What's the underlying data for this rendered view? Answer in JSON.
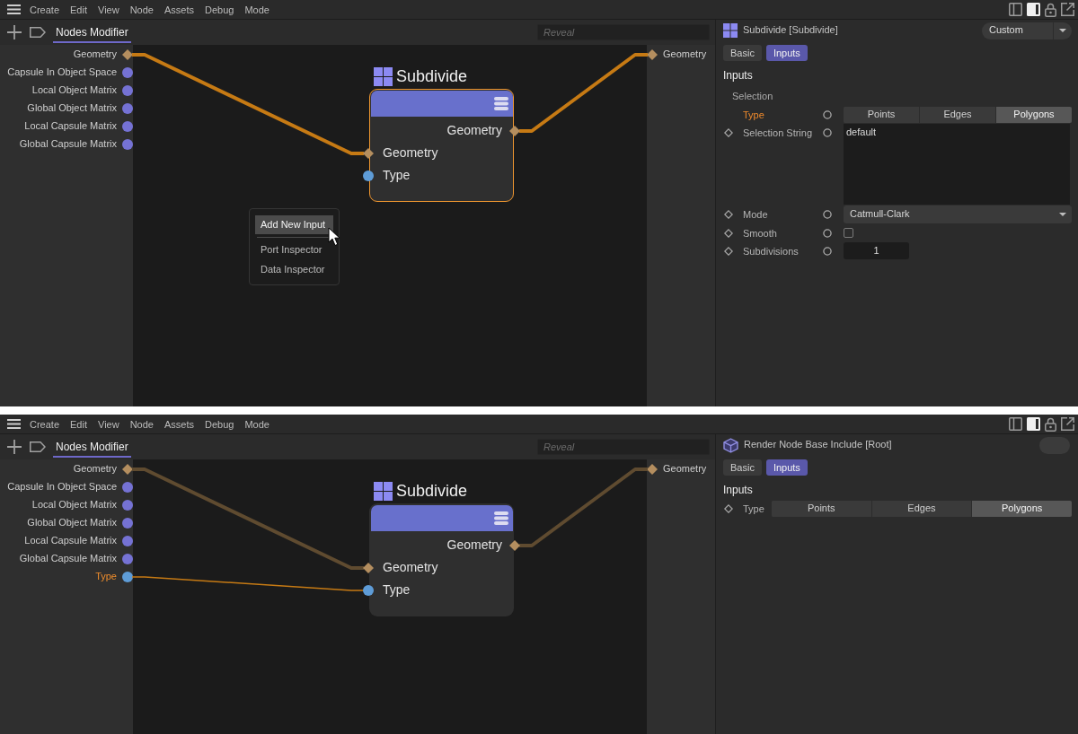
{
  "panels": [
    {
      "menu_bar": [
        "Create",
        "Edit",
        "View",
        "Node",
        "Assets",
        "Debug",
        "Mode"
      ],
      "editor": {
        "tabs": [
          {
            "label": "Nodes Modifier",
            "selected": true
          }
        ],
        "search": {
          "placeholder": "Reveal"
        },
        "graph_inputs": [
          {
            "label": "Geometry",
            "kind": "geometry",
            "highlighted": false,
            "wire": {
              "selected": true
            }
          },
          {
            "label": "Capsule In Object Space",
            "kind": "data",
            "highlighted": false
          },
          {
            "label": "Local Object Matrix",
            "kind": "data",
            "highlighted": false
          },
          {
            "label": "Global Object Matrix",
            "kind": "data",
            "highlighted": false
          },
          {
            "label": "Local Capsule Matrix",
            "kind": "data",
            "highlighted": false
          },
          {
            "label": "Global Capsule Matrix",
            "kind": "data",
            "highlighted": false
          }
        ],
        "node": {
          "title": "Subdivide",
          "selected": true,
          "outputs": [
            {
              "label": "Geometry",
              "kind": "geometry",
              "wire": {
                "selected": true
              }
            }
          ],
          "inputs": [
            {
              "label": "Geometry",
              "kind": "geometry"
            },
            {
              "label": "Type",
              "kind": "value"
            }
          ]
        },
        "context_menu": {
          "groups": [
            [
              {
                "label": "Add New Input",
                "selected": true
              }
            ],
            [
              {
                "label": "Port Inspector",
                "selected": false
              },
              {
                "label": "Data Inspector",
                "selected": false
              }
            ]
          ]
        },
        "graph_outputs": [
          {
            "label": "Geometry",
            "kind": "geometry"
          }
        ]
      },
      "attributes": {
        "header": {
          "kind": "node",
          "title": "Subdivide [Subdivide]",
          "preset": {
            "kind": "dropdown",
            "label": "Custom"
          }
        },
        "tabs": [
          {
            "label": "Basic",
            "selected": false
          },
          {
            "label": "Inputs",
            "selected": true
          }
        ],
        "sections": [
          {
            "title": "Inputs",
            "rows": [
              {
                "kind": "group",
                "label": "Selection"
              },
              {
                "kind": "segmented",
                "label": "Type",
                "keyframe": false,
                "port": true,
                "highlighted": true,
                "options": [
                  {
                    "label": "Points",
                    "selected": false
                  },
                  {
                    "label": "Edges",
                    "selected": false
                  },
                  {
                    "label": "Polygons",
                    "selected": true
                  }
                ]
              },
              {
                "kind": "text_area",
                "label": "Selection String",
                "keyframe": true,
                "port": true,
                "highlighted": false,
                "value": "default"
              },
              {
                "kind": "dropdown",
                "label": "Mode",
                "keyframe": true,
                "port": true,
                "highlighted": false,
                "value": "Catmull-Clark"
              },
              {
                "kind": "checkbox",
                "label": "Smooth",
                "keyframe": true,
                "port": true,
                "highlighted": false,
                "checked": false
              },
              {
                "kind": "number",
                "label": "Subdivisions",
                "keyframe": true,
                "port": true,
                "highlighted": false,
                "value": "1"
              }
            ]
          }
        ]
      }
    },
    {
      "menu_bar": [
        "Create",
        "Edit",
        "View",
        "Node",
        "Assets",
        "Debug",
        "Mode"
      ],
      "editor": {
        "tabs": [
          {
            "label": "Nodes Modifier",
            "selected": true
          }
        ],
        "search": {
          "placeholder": "Reveal"
        },
        "graph_inputs": [
          {
            "label": "Geometry",
            "kind": "geometry",
            "highlighted": false,
            "wire": {
              "selected": false
            }
          },
          {
            "label": "Capsule In Object Space",
            "kind": "data",
            "highlighted": false
          },
          {
            "label": "Local Object Matrix",
            "kind": "data",
            "highlighted": false
          },
          {
            "label": "Global Object Matrix",
            "kind": "data",
            "highlighted": false
          },
          {
            "label": "Local Capsule Matrix",
            "kind": "data",
            "highlighted": false
          },
          {
            "label": "Global Capsule Matrix",
            "kind": "data",
            "highlighted": false
          },
          {
            "label": "Type",
            "kind": "value",
            "highlighted": true,
            "wire": {
              "selected": true
            }
          }
        ],
        "node": {
          "title": "Subdivide",
          "selected": false,
          "outputs": [
            {
              "label": "Geometry",
              "kind": "geometry",
              "wire": {
                "selected": false
              }
            }
          ],
          "inputs": [
            {
              "label": "Geometry",
              "kind": "geometry"
            },
            {
              "label": "Type",
              "kind": "value"
            }
          ]
        },
        "graph_outputs": [
          {
            "label": "Geometry",
            "kind": "geometry"
          }
        ]
      },
      "attributes": {
        "header": {
          "kind": "root",
          "title": "Render Node Base Include [Root]",
          "preset": {
            "kind": "blank"
          }
        },
        "tabs": [
          {
            "label": "Basic",
            "selected": false
          },
          {
            "label": "Inputs",
            "selected": true
          }
        ],
        "sections": [
          {
            "title": "Inputs",
            "rows": [
              {
                "kind": "segmented",
                "label": "Type",
                "keyframe": true,
                "port": false,
                "highlighted": false,
                "options": [
                  {
                    "label": "Points",
                    "selected": false
                  },
                  {
                    "label": "Edges",
                    "selected": false
                  },
                  {
                    "label": "Polygons",
                    "selected": true
                  }
                ]
              }
            ]
          }
        ]
      }
    }
  ]
}
